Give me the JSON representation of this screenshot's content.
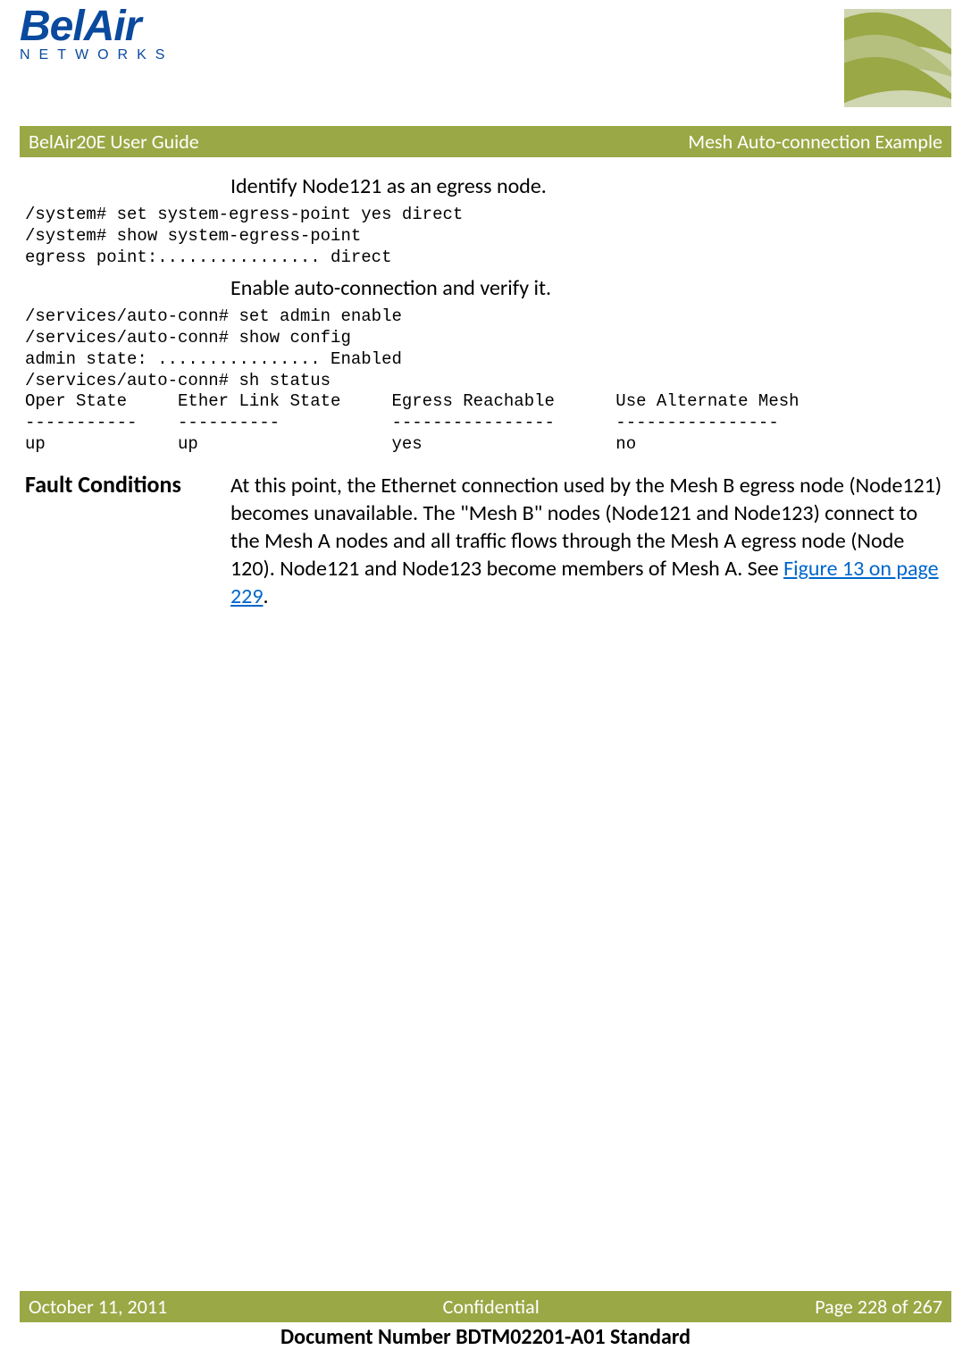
{
  "logo": {
    "top": "BelAir",
    "bottom": "NETWORKS"
  },
  "title_bar": {
    "left": "BelAir20E User Guide",
    "right": "Mesh Auto-connection Example"
  },
  "content": {
    "instr1": "Identify Node121 as an egress node.",
    "code1": "/system# set system-egress-point yes direct\n/system# show system-egress-point\negress point:................ direct",
    "instr2": "Enable auto-connection and verify it.",
    "code2": "/services/auto-conn# set admin enable\n/services/auto-conn# show config\nadmin state: ................ Enabled\n/services/auto-conn# sh status\nOper State     Ether Link State     Egress Reachable      Use Alternate Mesh\n-----------    ----------           ----------------      ----------------\nup             up                   yes                   no",
    "section_head": "Fault Conditions",
    "body_part1": "At this point, the Ethernet connection used by the Mesh B egress node (Node121) becomes unavailable. The \"Mesh B\" nodes (Node121 and Node123) connect to the Mesh A nodes and all traffic flows through the Mesh A egress node (Node 120). Node121 and Node123 become members of Mesh A. See ",
    "link_text": "Figure 13 on page 229",
    "body_part2": "."
  },
  "footer_bar": {
    "left": "October 11, 2011",
    "center": "Confidential",
    "right": "Page 228 of 267"
  },
  "doc_number": "Document Number BDTM02201-A01 Standard"
}
